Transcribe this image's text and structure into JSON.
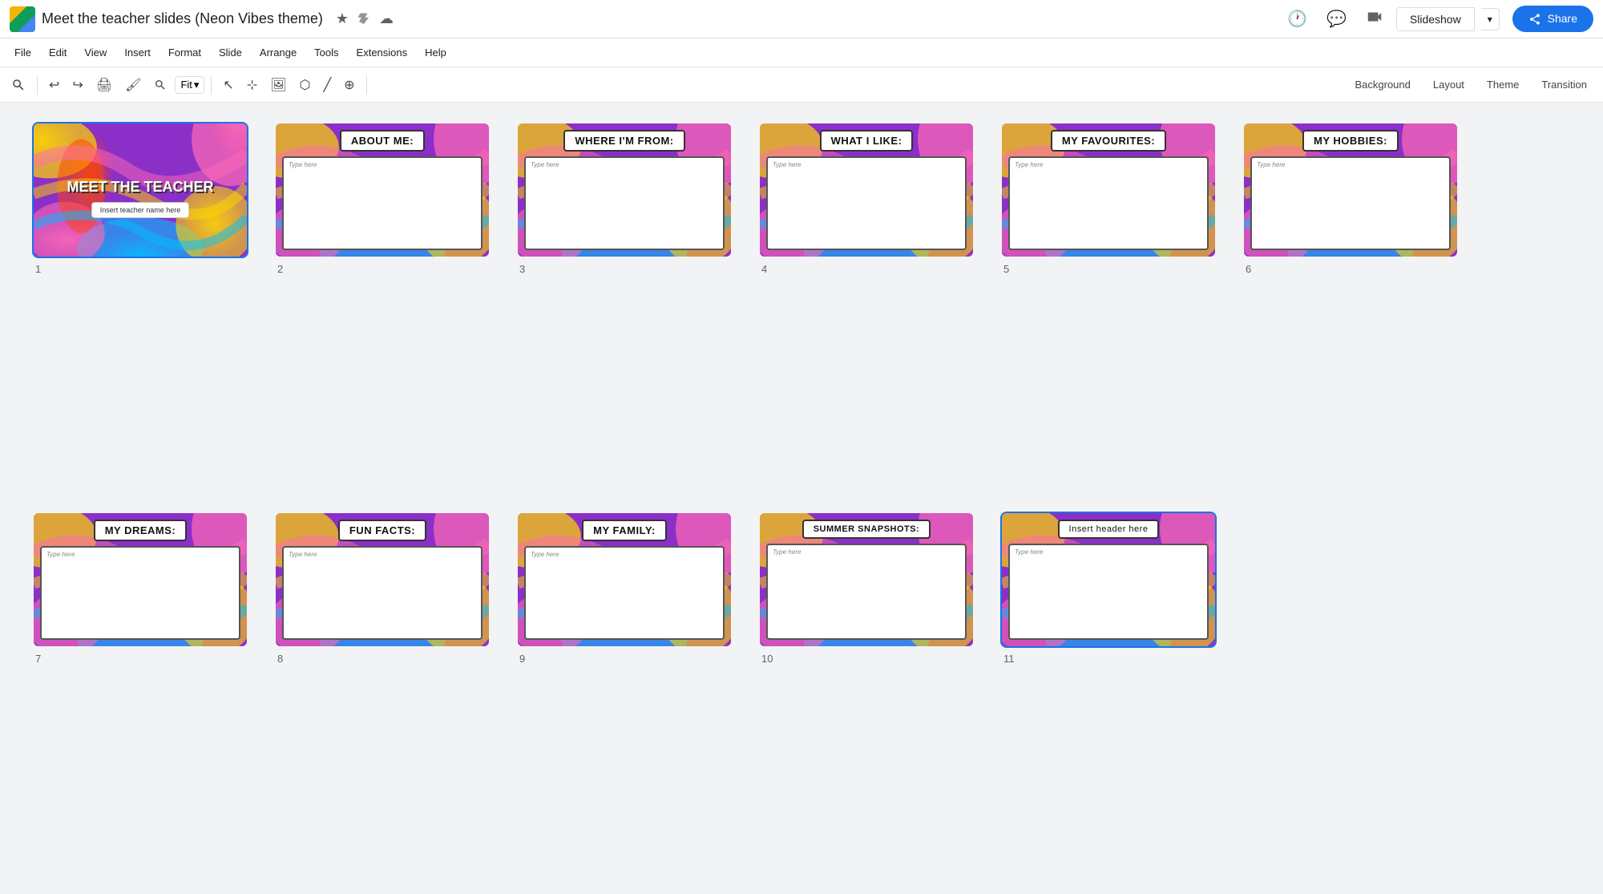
{
  "app": {
    "icon_label": "Google Slides",
    "doc_title": "Meet the teacher slides (Neon Vibes theme)",
    "star_icon": "⭐",
    "drive_icon": "📁",
    "cloud_icon": "☁"
  },
  "header_buttons": {
    "history": "🕐",
    "chat": "💬",
    "camera_label": "📷",
    "slideshow_label": "Slideshow",
    "share_label": "Share"
  },
  "menu": {
    "items": [
      "File",
      "Edit",
      "View",
      "Insert",
      "Format",
      "Slide",
      "Arrange",
      "Tools",
      "Extensions",
      "Help"
    ]
  },
  "toolbar": {
    "zoom_label": "Fit",
    "background_label": "Background",
    "layout_label": "Layout",
    "theme_label": "Theme",
    "transition_label": "Transition"
  },
  "slides": [
    {
      "number": "1",
      "type": "title",
      "title_line1": "MEET THE TEACHER",
      "name_placeholder": "Insert teacher name here",
      "selected": true
    },
    {
      "number": "2",
      "type": "content",
      "title": "ABOUT ME:",
      "placeholder": "Type here"
    },
    {
      "number": "3",
      "type": "content",
      "title": "WHERE I'M FROM:",
      "placeholder": "Type here"
    },
    {
      "number": "4",
      "type": "content",
      "title": "WHAT I LIKE:",
      "placeholder": "Type here"
    },
    {
      "number": "5",
      "type": "content",
      "title": "MY FAVOURITES:",
      "placeholder": "Type here"
    },
    {
      "number": "6",
      "type": "content",
      "title": "MY HOBBIES:",
      "placeholder": "Type here"
    },
    {
      "number": "7",
      "type": "content",
      "title": "MY DREAMS:",
      "placeholder": "Type here"
    },
    {
      "number": "8",
      "type": "content",
      "title": "FUN FACTS:",
      "placeholder": "Type here"
    },
    {
      "number": "9",
      "type": "content",
      "title": "MY FAMILY:",
      "placeholder": "Type here"
    },
    {
      "number": "10",
      "type": "content",
      "title": "SUMMER SNAPSHOTS:",
      "placeholder": "Type here"
    },
    {
      "number": "11",
      "type": "content",
      "title": "Insert header here",
      "title_style": "plain",
      "placeholder": "Type here",
      "selected": true
    }
  ],
  "colors": {
    "neon_purple": "#8B2FC9",
    "neon_yellow": "#FFD700",
    "neon_pink": "#FF69B4",
    "neon_blue": "#00BFFF",
    "accent_blue": "#1a73e8"
  }
}
